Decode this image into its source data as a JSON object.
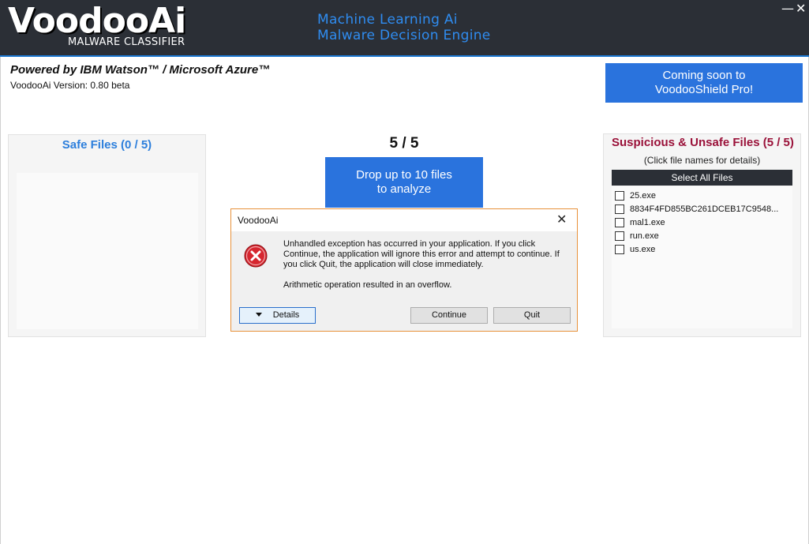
{
  "header": {
    "logo": "VoodooAi",
    "logo_sub": "MALWARE CLASSIFIER",
    "tagline_line1": "Machine Learning Ai",
    "tagline_line2": "Malware Decision Engine",
    "minimize": "—",
    "close": "✕"
  },
  "powered_by": "Powered by IBM Watson™ / Microsoft Azure™",
  "version": "VoodooAi Version: 0.80 beta",
  "coming_soon": {
    "line1": "Coming soon to",
    "line2": "VoodooShield Pro!"
  },
  "safe_panel": {
    "title": "Safe Files (0 / 5)"
  },
  "counter": "5 / 5",
  "drop_button": {
    "line1": "Drop up to 10 files",
    "line2": "to analyze"
  },
  "suspicious_panel": {
    "title": "Suspicious & Unsafe Files (5 / 5)",
    "hint": "(Click file names for details)",
    "select_all": "Select All Files",
    "files": [
      "25.exe",
      "8834F4FD855BC261DCEB17C9548...",
      "mal1.exe",
      "run.exe",
      "us.exe"
    ]
  },
  "dialog": {
    "title": "VoodooAi",
    "close": "✕",
    "message": "Unhandled exception has occurred in your application. If you click Continue, the application will ignore this error and attempt to continue. If you click Quit, the application will close immediately.",
    "detail": "Arithmetic operation resulted in an overflow.",
    "details_button": "Details",
    "continue_button": "Continue",
    "quit_button": "Quit"
  },
  "colors": {
    "header_bg": "#2b2f36",
    "accent_blue": "#2a73dd",
    "tagline_blue": "#2f8cf0",
    "unsafe_red": "#9a1139",
    "error_red": "#d6262f"
  }
}
